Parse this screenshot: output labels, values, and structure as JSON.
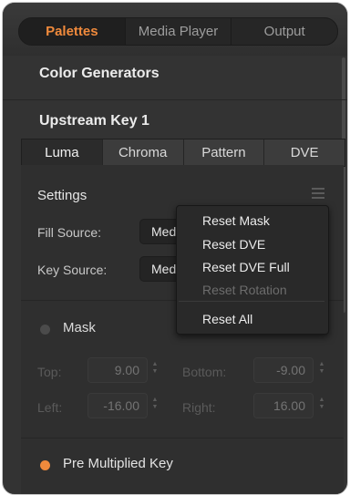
{
  "top_tabs": [
    "Palettes",
    "Media Player",
    "Output"
  ],
  "sections": {
    "color_generators": "Color Generators",
    "upstream_key": "Upstream Key 1"
  },
  "key_tabs": [
    "Luma",
    "Chroma",
    "Pattern",
    "DVE"
  ],
  "settings": {
    "title": "Settings",
    "fill_source_label": "Fill Source:",
    "fill_source_value": "Med",
    "key_source_label": "Key Source:",
    "key_source_value": "Med"
  },
  "context_menu": {
    "items": [
      "Reset Mask",
      "Reset DVE",
      "Reset DVE Full",
      "Reset Rotation",
      "Reset All"
    ]
  },
  "mask": {
    "label": "Mask",
    "top_label": "Top:",
    "top_value": "9.00",
    "bottom_label": "Bottom:",
    "bottom_value": "-9.00",
    "left_label": "Left:",
    "left_value": "-16.00",
    "right_label": "Right:",
    "right_value": "16.00"
  },
  "pre_multiplied": {
    "label": "Pre Multiplied Key"
  },
  "colors": {
    "accent": "#f08a3c"
  }
}
